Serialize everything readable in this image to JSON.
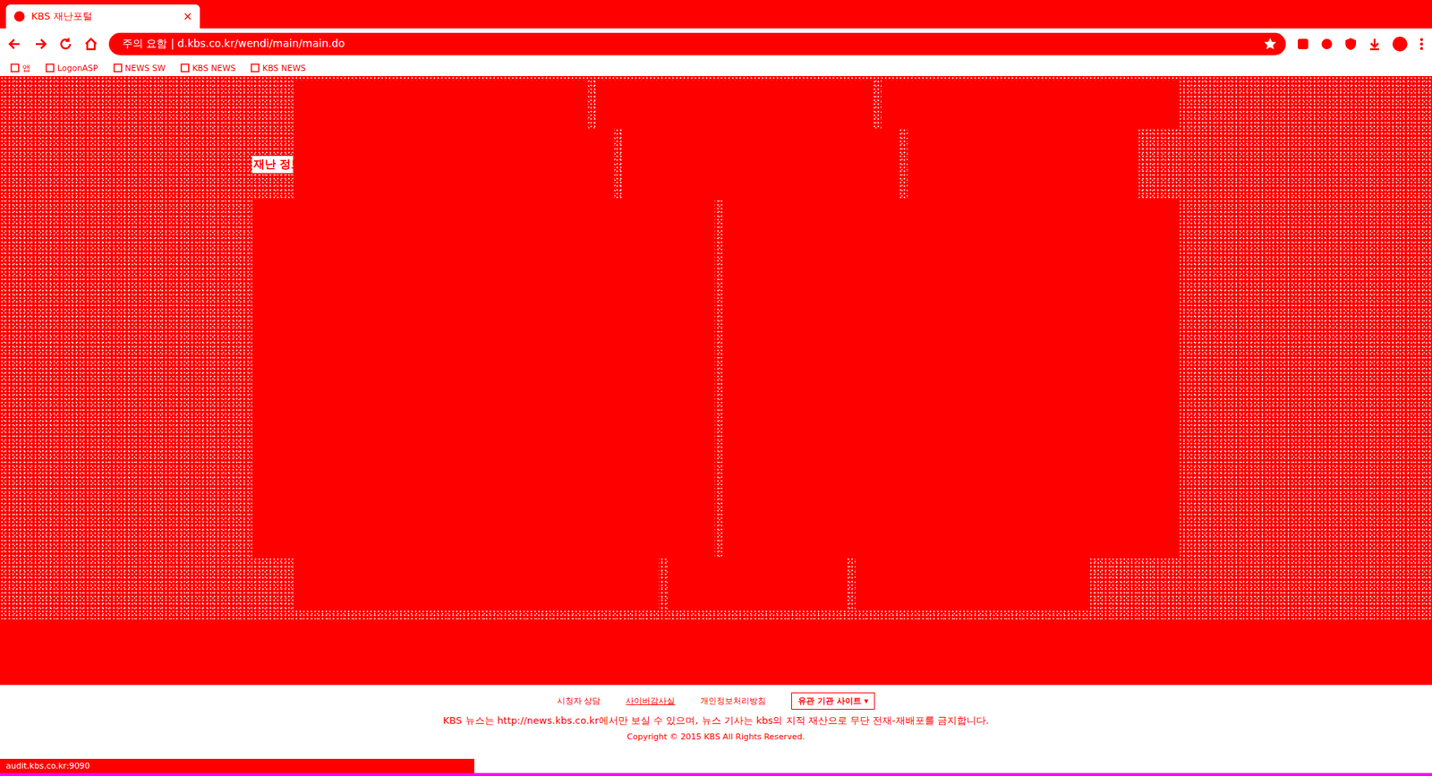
{
  "window": {
    "tab_title": "KBS 재난포털",
    "tab_close": "×",
    "url": "주의 요함 | d.kbs.co.kr/wendi/main/main.do"
  },
  "bookmarks": [
    {
      "label": "앱"
    },
    {
      "label": "LogonASP"
    },
    {
      "label": "NEWS SW"
    },
    {
      "label": "KBS NEWS"
    },
    {
      "label": "KBS NEWS"
    }
  ],
  "page": {
    "heading": "재난 정보"
  },
  "footer": {
    "links": [
      {
        "label": "시청자 상담",
        "underlined": false
      },
      {
        "label": "사이버감사실",
        "underlined": true
      },
      {
        "label": "개인정보처리방침",
        "underlined": false
      }
    ],
    "related_sites": "유관 기관 사이트 ▾",
    "notice": "KBS 뉴스는 http://news.kbs.co.kr에서만 보실 수 있으며, 뉴스 기사는 kbs의 지적 재산으로 무단 전재-재배포를 금지합니다.",
    "copyright": "Copyright © 2015 KBS All Rights Reserved."
  },
  "status_bar": {
    "text": "audit.kbs.co.kr:9090"
  }
}
